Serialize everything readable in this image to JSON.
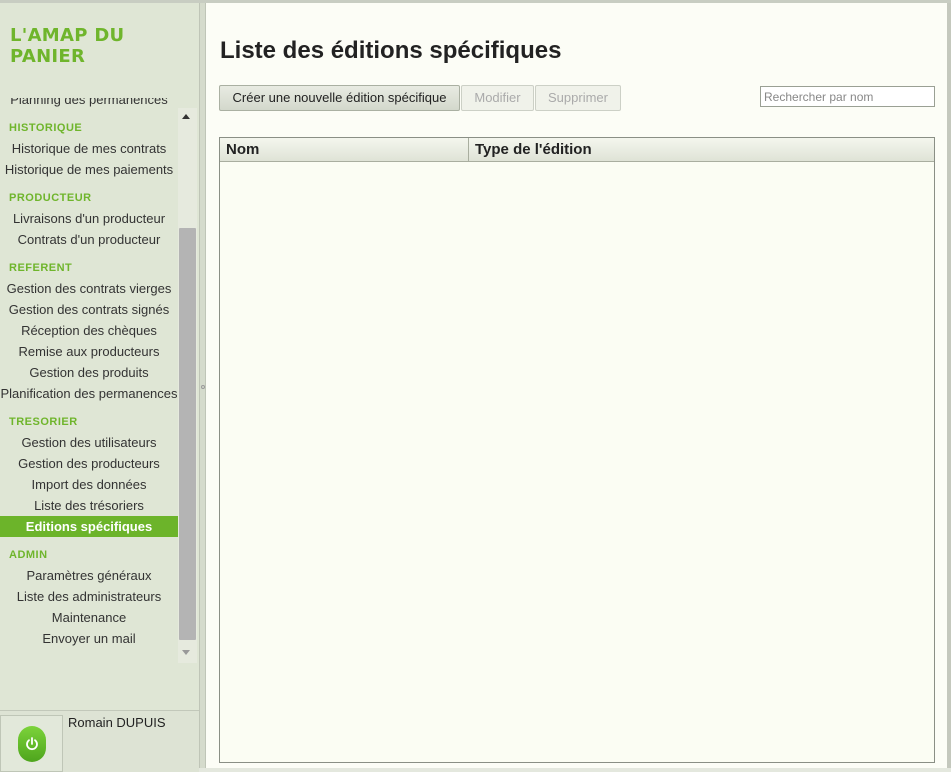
{
  "app": {
    "title": "L'AMAP DU PANIER"
  },
  "sidebar": {
    "partial_item": "Planning des permanences",
    "sections": [
      {
        "title": "HISTORIQUE",
        "items": [
          "Historique de mes contrats",
          "Historique de mes paiements"
        ]
      },
      {
        "title": "PRODUCTEUR",
        "items": [
          "Livraisons d'un producteur",
          "Contrats d'un producteur"
        ]
      },
      {
        "title": "REFERENT",
        "items": [
          "Gestion des contrats vierges",
          "Gestion des contrats signés",
          "Réception des chèques",
          "Remise aux producteurs",
          "Gestion des produits",
          "Planification des permanences"
        ]
      },
      {
        "title": "TRESORIER",
        "items": [
          "Gestion des utilisateurs",
          "Gestion des producteurs",
          "Import des données",
          "Liste des trésoriers",
          "Editions spécifiques"
        ]
      },
      {
        "title": "ADMIN",
        "items": [
          "Paramètres généraux",
          "Liste des administrateurs",
          "Maintenance",
          "Envoyer un mail"
        ]
      }
    ],
    "active_item": "Editions spécifiques"
  },
  "user": {
    "name": "Romain DUPUIS",
    "logout_icon": "power-icon"
  },
  "main": {
    "title": "Liste des éditions spécifiques",
    "buttons": {
      "create": "Créer une nouvelle édition spécifique",
      "edit": "Modifier",
      "delete": "Supprimer"
    },
    "search": {
      "placeholder": "Rechercher par nom",
      "value": ""
    },
    "table": {
      "columns": [
        "Nom",
        "Type de l'édition"
      ],
      "rows": []
    }
  },
  "colors": {
    "accent": "#6cb42a",
    "section": "#6fb52c",
    "background": "#fcfdf6"
  }
}
